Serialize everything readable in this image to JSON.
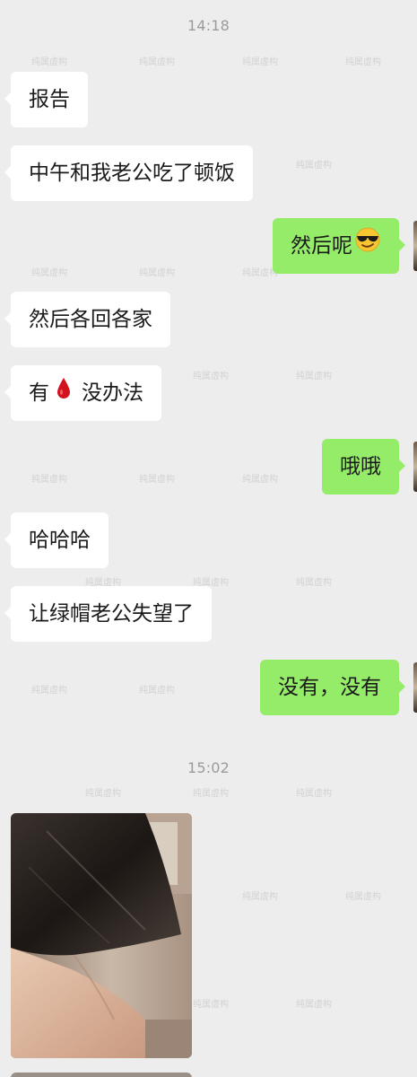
{
  "timestamps": [
    "14:18",
    "15:02"
  ],
  "messages": [
    {
      "side": "left",
      "text": "报告"
    },
    {
      "side": "left",
      "text": "中午和我老公吃了顿饭"
    },
    {
      "side": "right",
      "text": "然后呢",
      "emoji": "sunglasses-face"
    },
    {
      "side": "left",
      "text": "然后各回各家"
    },
    {
      "side": "left",
      "text_before": "有",
      "icon": "blood-drop",
      "text_after": "没办法"
    },
    {
      "side": "right",
      "text": "哦哦"
    },
    {
      "side": "left",
      "text": "哈哈哈"
    },
    {
      "side": "left",
      "text": "让绿帽老公失望了"
    },
    {
      "side": "right",
      "text": "没有，没有"
    }
  ],
  "watermark_text": "纯属虚构",
  "colors": {
    "background": "#ededed",
    "bubble_left": "#ffffff",
    "bubble_right": "#95ec69",
    "timestamp": "#9b9b9b",
    "blood_drop": "#d4111e"
  }
}
